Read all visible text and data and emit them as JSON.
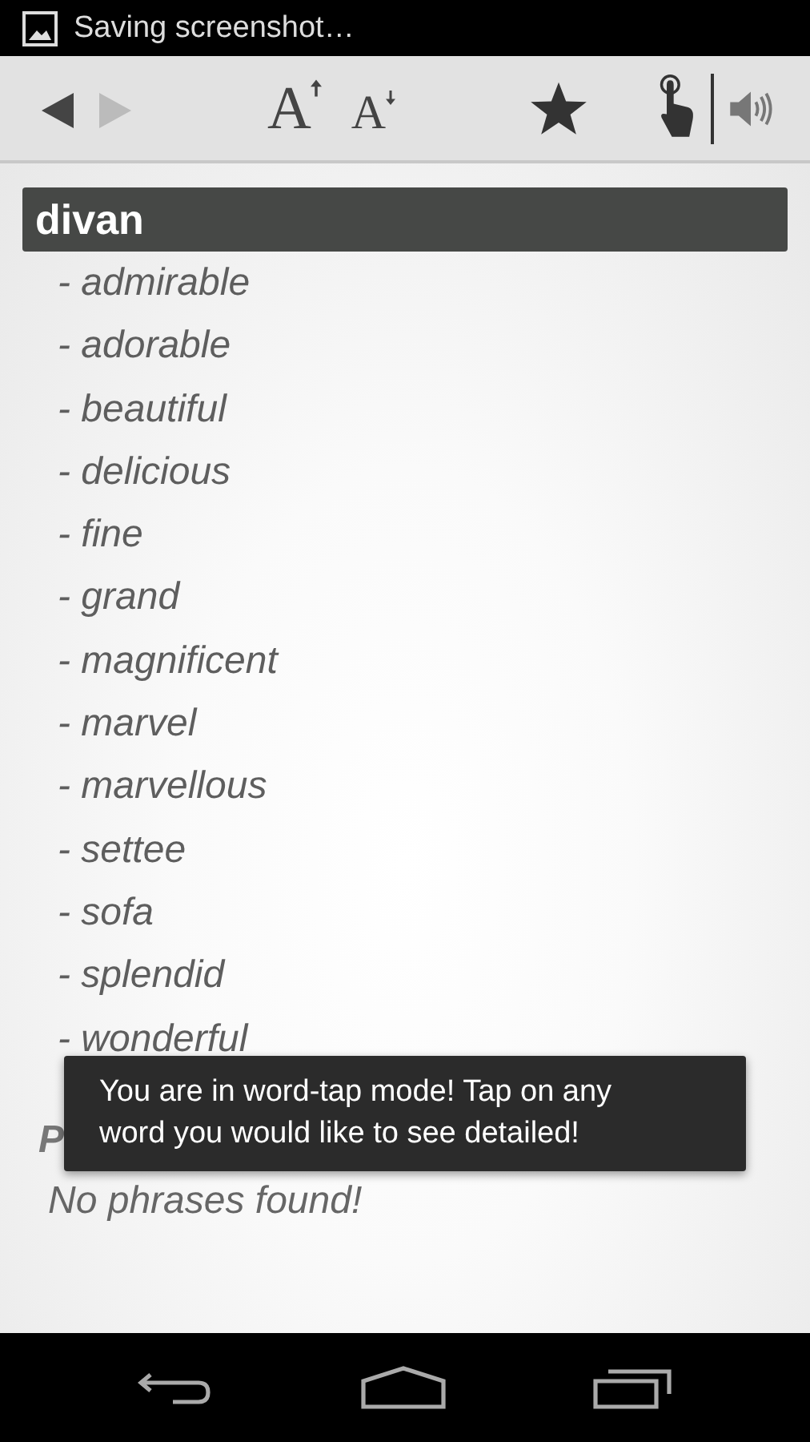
{
  "status_bar": {
    "notification": "Saving screenshot…"
  },
  "toolbar": {
    "back": {
      "disabled": false
    },
    "forward": {
      "disabled": true
    },
    "font_bigger": {
      "label": "A"
    },
    "font_smaller": {
      "label": "A"
    },
    "word_tap": {
      "on": true
    }
  },
  "entry": {
    "headword": "divan",
    "words": [
      "- admirable",
      "- adorable",
      "- beautiful",
      "- delicious",
      "- fine",
      "- grand",
      "- magnificent",
      "- marvel",
      "- marvellous",
      "- settee",
      "- sofa",
      "- splendid",
      "- wonderful"
    ]
  },
  "phrases": {
    "heading": "P",
    "message": "No phrases found!"
  },
  "toast": {
    "text": "You are in word-tap mode! Tap on any word you would like to see detailed!"
  }
}
